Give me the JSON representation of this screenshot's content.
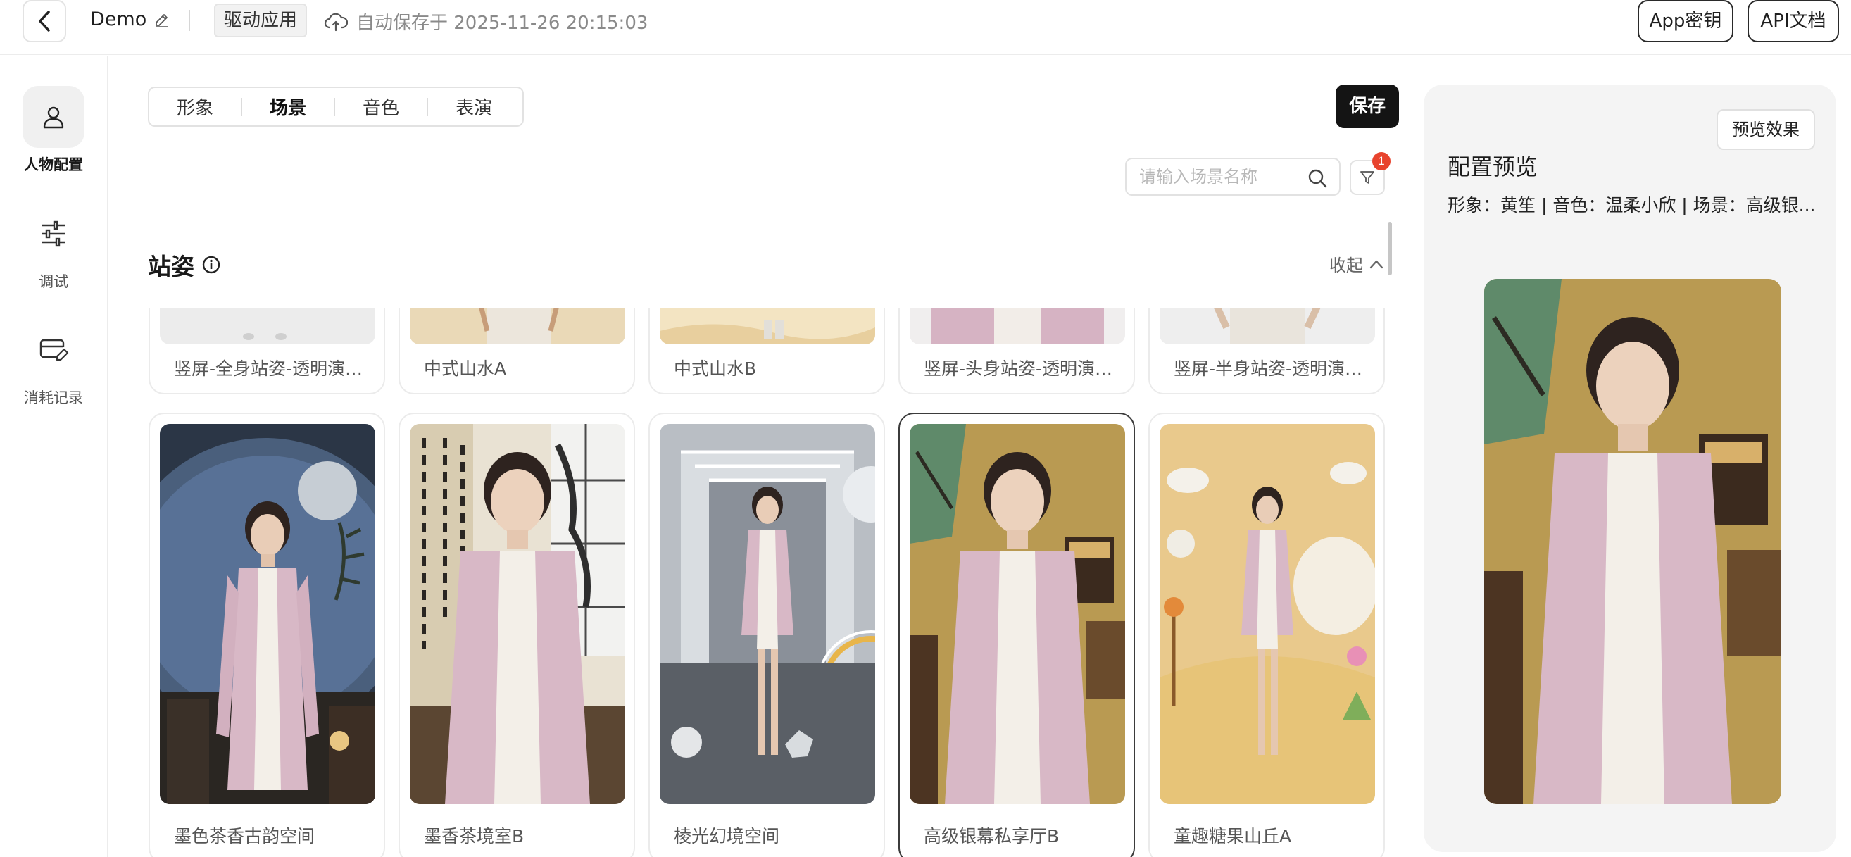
{
  "header": {
    "back_icon": "chevron-left-icon",
    "app_name": "Demo",
    "edit_icon": "pencil-icon",
    "tag": "驱动应用",
    "autosave_icon": "cloud-icon",
    "autosave_text": "自动保存于 2025-11-26 20:15:03",
    "app_key_label": "App密钥",
    "api_doc_label": "API文档"
  },
  "sidebar": {
    "items": [
      {
        "label": "人物配置",
        "icon": "user-icon",
        "active": true
      },
      {
        "label": "调试",
        "icon": "sliders-icon",
        "active": false
      },
      {
        "label": "消耗记录",
        "icon": "wallet-edit-icon",
        "active": false
      }
    ]
  },
  "main": {
    "tabs": [
      {
        "label": "形象",
        "active": false
      },
      {
        "label": "场景",
        "active": true
      },
      {
        "label": "音色",
        "active": false
      },
      {
        "label": "表演",
        "active": false
      }
    ],
    "save_label": "保存",
    "search_placeholder": "请输入场景名称",
    "filter_badge": "1",
    "section_title": "站姿",
    "collapse_label": "收起",
    "top_row": [
      {
        "label": "竖屏-全身站姿-透明演播..."
      },
      {
        "label": "中式山水A"
      },
      {
        "label": "中式山水B"
      },
      {
        "label": "竖屏-头身站姿-透明演播..."
      },
      {
        "label": "竖屏-半身站姿-透明演播..."
      }
    ],
    "cards": [
      {
        "label": "墨色茶香古韵空间",
        "selected": false
      },
      {
        "label": "墨香茶境室B",
        "selected": false
      },
      {
        "label": "棱光幻境空间",
        "selected": false
      },
      {
        "label": "高级银幕私享厅B",
        "selected": true
      },
      {
        "label": "童趣糖果山丘A",
        "selected": false
      }
    ]
  },
  "preview": {
    "button_label": "预览效果",
    "title": "配置预览",
    "description": "形象：黄笙 | 音色：温柔小欣 | 场景：高级银..."
  },
  "colors": {
    "accent_dark": "#141414",
    "badge_red": "#e8432d",
    "panel_bg": "#f4f4f4",
    "jacket_pink": "#d8b8c6"
  }
}
